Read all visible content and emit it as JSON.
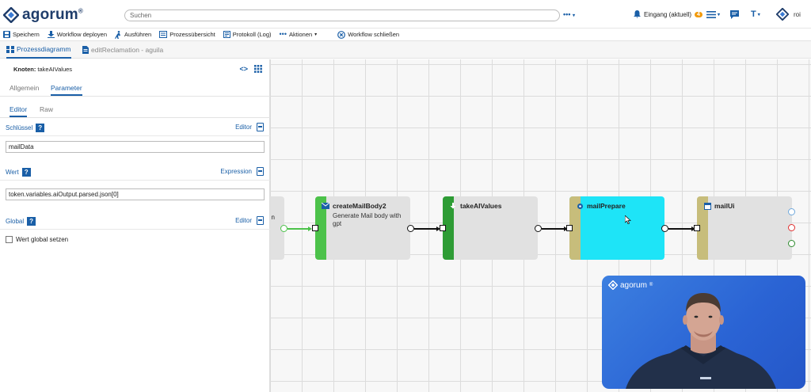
{
  "app": {
    "logo_text": "agorum",
    "logo_reg": "®"
  },
  "header": {
    "search_placeholder": "Suchen",
    "more_label": "•••",
    "inbox_label": "Eingang (aktuell)",
    "inbox_count": "4",
    "user_initials": "roi"
  },
  "toolbar": {
    "items": [
      {
        "icon": "save-icon",
        "label": "Speichern"
      },
      {
        "icon": "deploy-icon",
        "label": "Workflow deployen"
      },
      {
        "icon": "run-icon",
        "label": "Ausführen"
      },
      {
        "icon": "overview-icon",
        "label": "Prozessübersicht"
      },
      {
        "icon": "log-icon",
        "label": "Protokoll (Log)"
      },
      {
        "icon": "more-icon",
        "label": "Aktionen"
      },
      {
        "icon": "close-circle-icon",
        "label": "Workflow schließen"
      }
    ]
  },
  "tabs": [
    {
      "label": "Prozessdiagramm",
      "active": true
    },
    {
      "label": "editReclamation - aguila",
      "active": false
    }
  ],
  "panel": {
    "node_label": "Knoten:",
    "node_name": "takeAIValues",
    "tabs": [
      "Allgemein",
      "Parameter"
    ],
    "subtabs": [
      "Editor",
      "Raw"
    ],
    "key_label": "Schlüssel",
    "key_mode": "Editor",
    "key_value": "mailData",
    "value_label": "Wert",
    "value_mode": "Expression",
    "value_value": "token.variables.aiOutput.parsed.json[0]",
    "global_label": "Global",
    "global_mode": "Editor",
    "global_checkbox_label": "Wert global setzen",
    "global_checked": false
  },
  "diagram": {
    "nodes": [
      {
        "title": "",
        "desc": "n",
        "color": "#cccccc"
      },
      {
        "title": "createMailBody2",
        "desc": "Generate Mail body with gpt",
        "color": "#4cc24a"
      },
      {
        "title": "takeAIValues",
        "desc": "",
        "color": "#2e9c35"
      },
      {
        "title": "mailPrepare",
        "desc": "",
        "color": "#c7bd7b",
        "selected": true,
        "fill": "#1ee4f7"
      },
      {
        "title": "mailUi",
        "desc": "",
        "color": "#c7bd7b"
      }
    ],
    "exit_ports": [
      "#6fa8dc",
      "#e03030",
      "#2e8b2e"
    ]
  },
  "video": {
    "logo_text": "agorum",
    "logo_reg": "®"
  }
}
